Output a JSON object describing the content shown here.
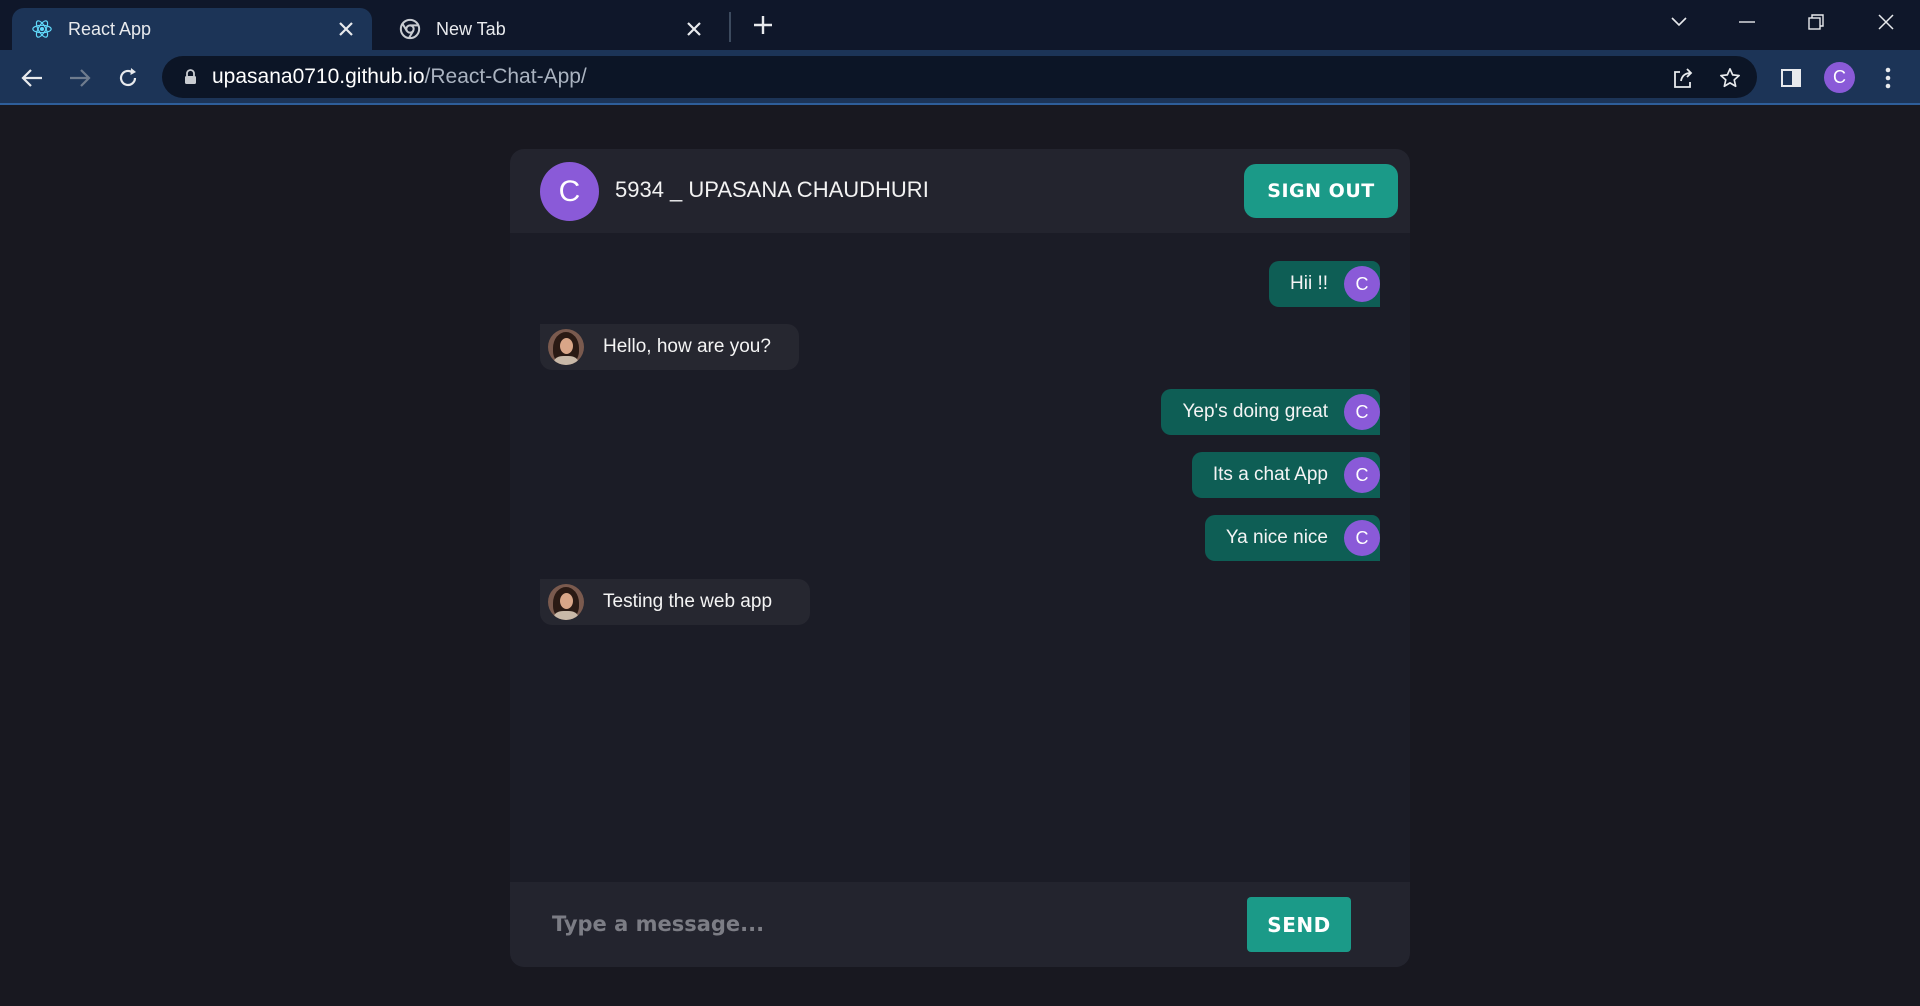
{
  "browser": {
    "tabs": [
      {
        "title": "React App",
        "active": true,
        "icon": "react-logo-icon"
      },
      {
        "title": "New Tab",
        "active": false,
        "icon": "chrome-logo-icon"
      }
    ],
    "url_host": "upasana0710.github.io",
    "url_path": "/React-Chat-App/",
    "profile_initial": "C",
    "accent_color": "#1c3457"
  },
  "chat": {
    "header": {
      "avatar_initial": "C",
      "user_name": "5934 _ UPASANA CHAUDHURI",
      "signout_label": "SIGN OUT"
    },
    "messages": [
      {
        "text": "Hii !!",
        "direction": "sent",
        "avatar": "C"
      },
      {
        "text": "Hello, how are you?",
        "direction": "received",
        "avatar": "user-photo"
      },
      {
        "text": "Yep's doing great",
        "direction": "sent",
        "avatar": "C"
      },
      {
        "text": "Its a chat App",
        "direction": "sent",
        "avatar": "C"
      },
      {
        "text": "Ya nice nice",
        "direction": "sent",
        "avatar": "C"
      },
      {
        "text": "Testing the web app",
        "direction": "received",
        "avatar": "user-photo"
      }
    ],
    "composer": {
      "placeholder": "Type a message...",
      "value": "",
      "send_label": "SEND"
    },
    "colors": {
      "sent_bubble": "#0e5e55",
      "received_bubble": "#262730",
      "button": "#1b9a88",
      "avatar": "#8a5ad8"
    }
  }
}
